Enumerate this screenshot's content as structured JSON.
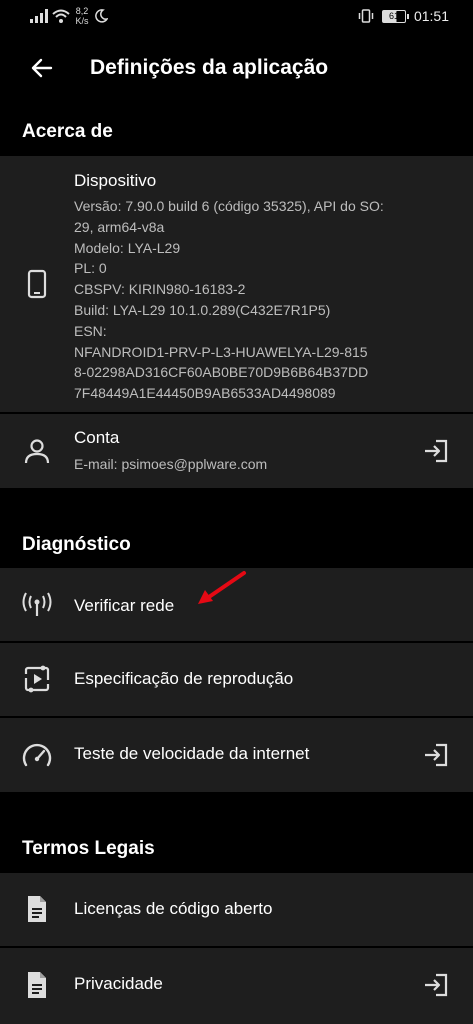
{
  "status_bar": {
    "network_speed_value": "8,2",
    "network_speed_unit": "K/s",
    "battery_level": "61",
    "time": "01:51"
  },
  "header": {
    "title": "Definições da aplicação"
  },
  "sections": {
    "about": {
      "title": "Acerca de",
      "device": {
        "label": "Dispositivo",
        "lines": [
          "Versão: 7.90.0 build 6 (código 35325), API do SO:",
          "29, arm64-v8a",
          "Modelo: LYA-L29",
          "PL: 0",
          "CBSPV: KIRIN980-16183-2",
          "Build: LYA-L29 10.1.0.289(C432E7R1P5)",
          "ESN:",
          "NFANDROID1-PRV-P-L3-HUAWELYA-L29-815",
          "8-02298AD316CF60AB0BE70D9B6B64B37DD",
          "7F48449A1E44450B9AB6533AD4498089"
        ]
      },
      "account": {
        "label": "Conta",
        "email": "E-mail: psimoes@pplware.com"
      }
    },
    "diagnostics": {
      "title": "Diagnóstico",
      "items": [
        {
          "label": "Verificar rede"
        },
        {
          "label": "Especificação de reprodução"
        },
        {
          "label": "Teste de velocidade da internet"
        }
      ]
    },
    "legal": {
      "title": "Termos Legais",
      "items": [
        {
          "label": "Licenças de código aberto"
        },
        {
          "label": "Privacidade"
        }
      ]
    }
  },
  "colors": {
    "background": "#000000",
    "card": "#1e1e1e",
    "secondary_text": "#bdbdbd",
    "annotation_arrow": "#e50914"
  }
}
